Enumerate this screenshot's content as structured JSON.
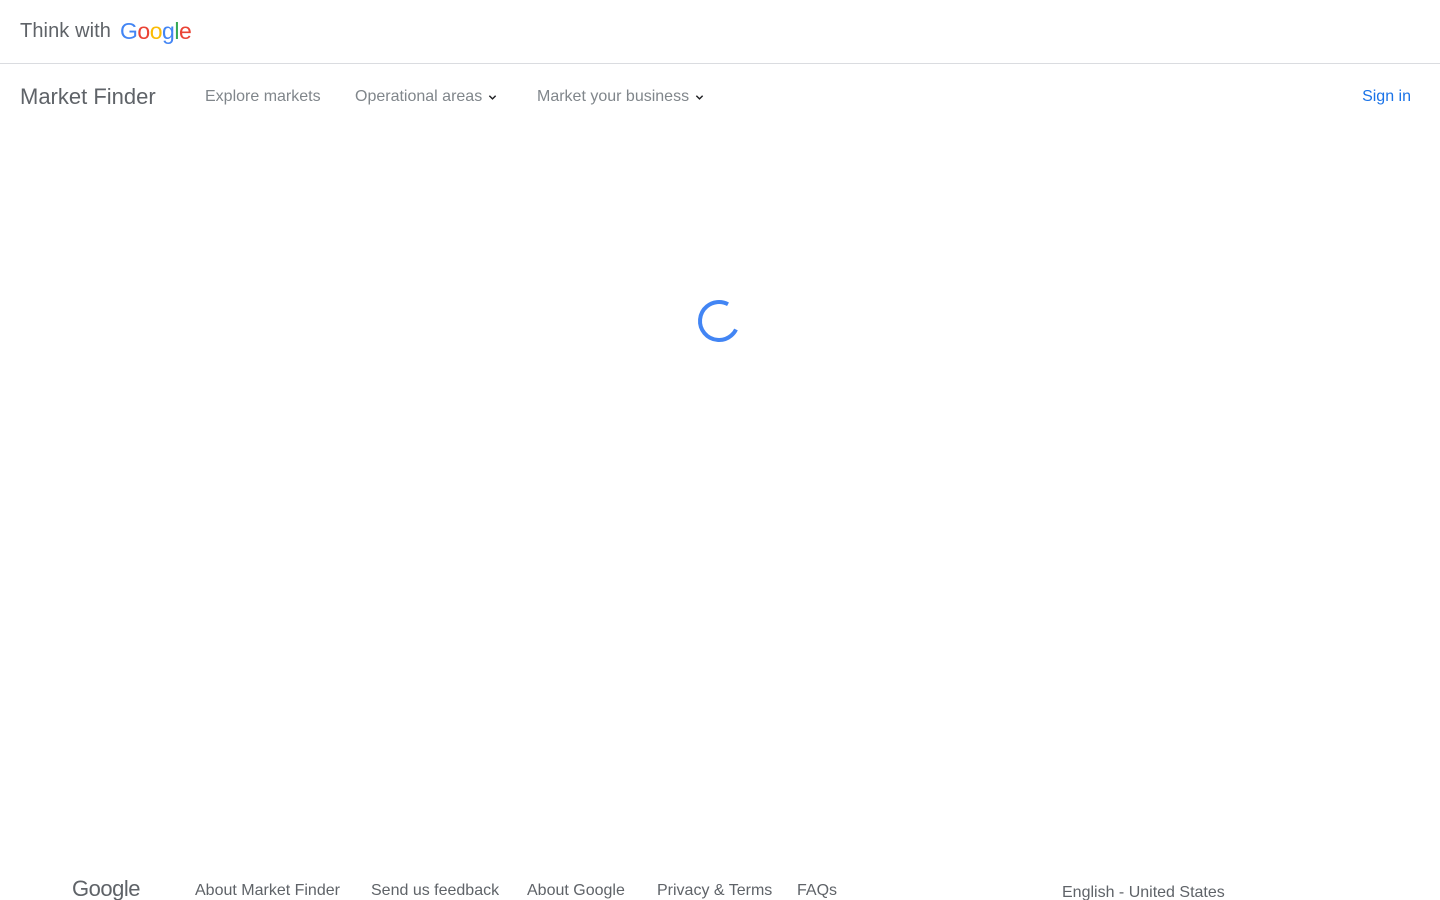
{
  "header": {
    "brand_prefix": "Think with",
    "brand_letters": [
      {
        "char": "G",
        "color": "#4285F4"
      },
      {
        "char": "o",
        "color": "#EA4335"
      },
      {
        "char": "o",
        "color": "#FBBC05"
      },
      {
        "char": "g",
        "color": "#4285F4"
      },
      {
        "char": "l",
        "color": "#34A853"
      },
      {
        "char": "e",
        "color": "#EA4335"
      }
    ]
  },
  "nav": {
    "app_title": "Market Finder",
    "items": [
      {
        "label": "Explore markets",
        "has_dropdown": false
      },
      {
        "label": "Operational areas",
        "has_dropdown": true
      },
      {
        "label": "Market your business",
        "has_dropdown": true
      }
    ],
    "sign_in": "Sign in"
  },
  "main": {
    "loading_icon": "loading-spinner-icon",
    "accent_color": "#4285F4"
  },
  "footer": {
    "logo_text": "Google",
    "links": [
      "About Market Finder",
      "Send us feedback",
      "About Google",
      "Privacy & Terms",
      "FAQs"
    ],
    "language": "English - United States"
  }
}
